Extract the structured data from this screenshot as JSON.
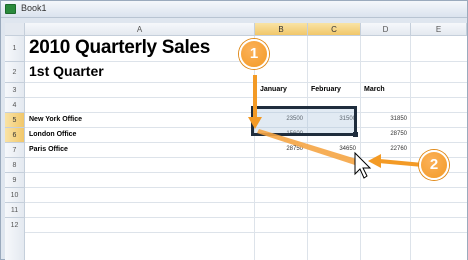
{
  "window": {
    "title": "Book1"
  },
  "columns": [
    "A",
    "B",
    "C",
    "D",
    "E"
  ],
  "rows": [
    "1",
    "2",
    "3",
    "4",
    "5",
    "6",
    "7",
    "8",
    "9",
    "10",
    "11",
    "12"
  ],
  "sheet": {
    "title": "2010 Quarterly Sales",
    "subtitle": "1st Quarter",
    "month_headers": [
      "January",
      "February",
      "March"
    ],
    "offices": [
      "New York Office",
      "London Office",
      "Paris Office"
    ],
    "values": [
      [
        "23500",
        "31500",
        "31850"
      ],
      [
        "15600",
        "",
        "28750"
      ],
      [
        "28750",
        "34650",
        "22760"
      ]
    ]
  },
  "callouts": [
    "1",
    "2"
  ],
  "colors": {
    "callout": "#f39a25",
    "selection_header": "#f1c76a",
    "excel_green": "#2a8a3c"
  }
}
